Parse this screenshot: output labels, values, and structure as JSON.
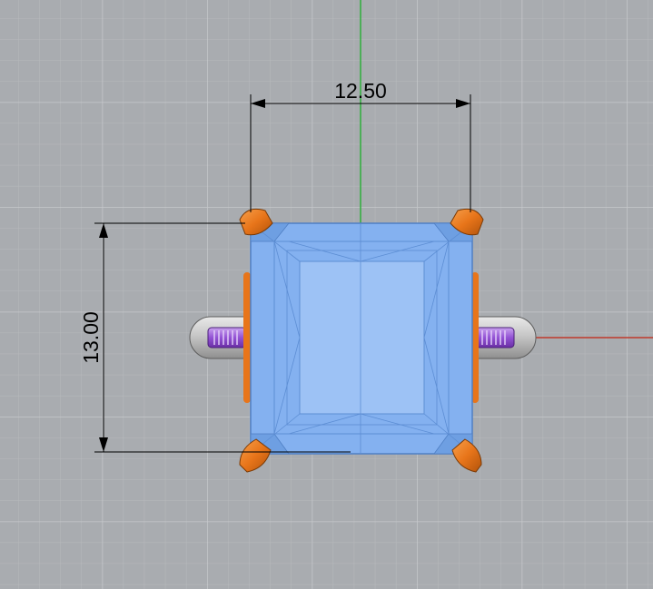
{
  "viewport": {
    "background": "#a9acb0",
    "grid_minor_color": "#b8babd",
    "grid_major_color": "#c6c8cb",
    "axis_y_color": "#2fae3b",
    "axis_x_color": "#c0392b"
  },
  "dimensions": {
    "width_value": "12.50",
    "height_value": "13.00",
    "line_color": "#000000"
  },
  "model": {
    "gem_color": "#7aa9ec",
    "gem_edge_color": "#4f7fc4",
    "prong_color": "#ee7b1c",
    "bezel_color": "#c9c9c9",
    "screw_color": "#9a5fd0"
  }
}
